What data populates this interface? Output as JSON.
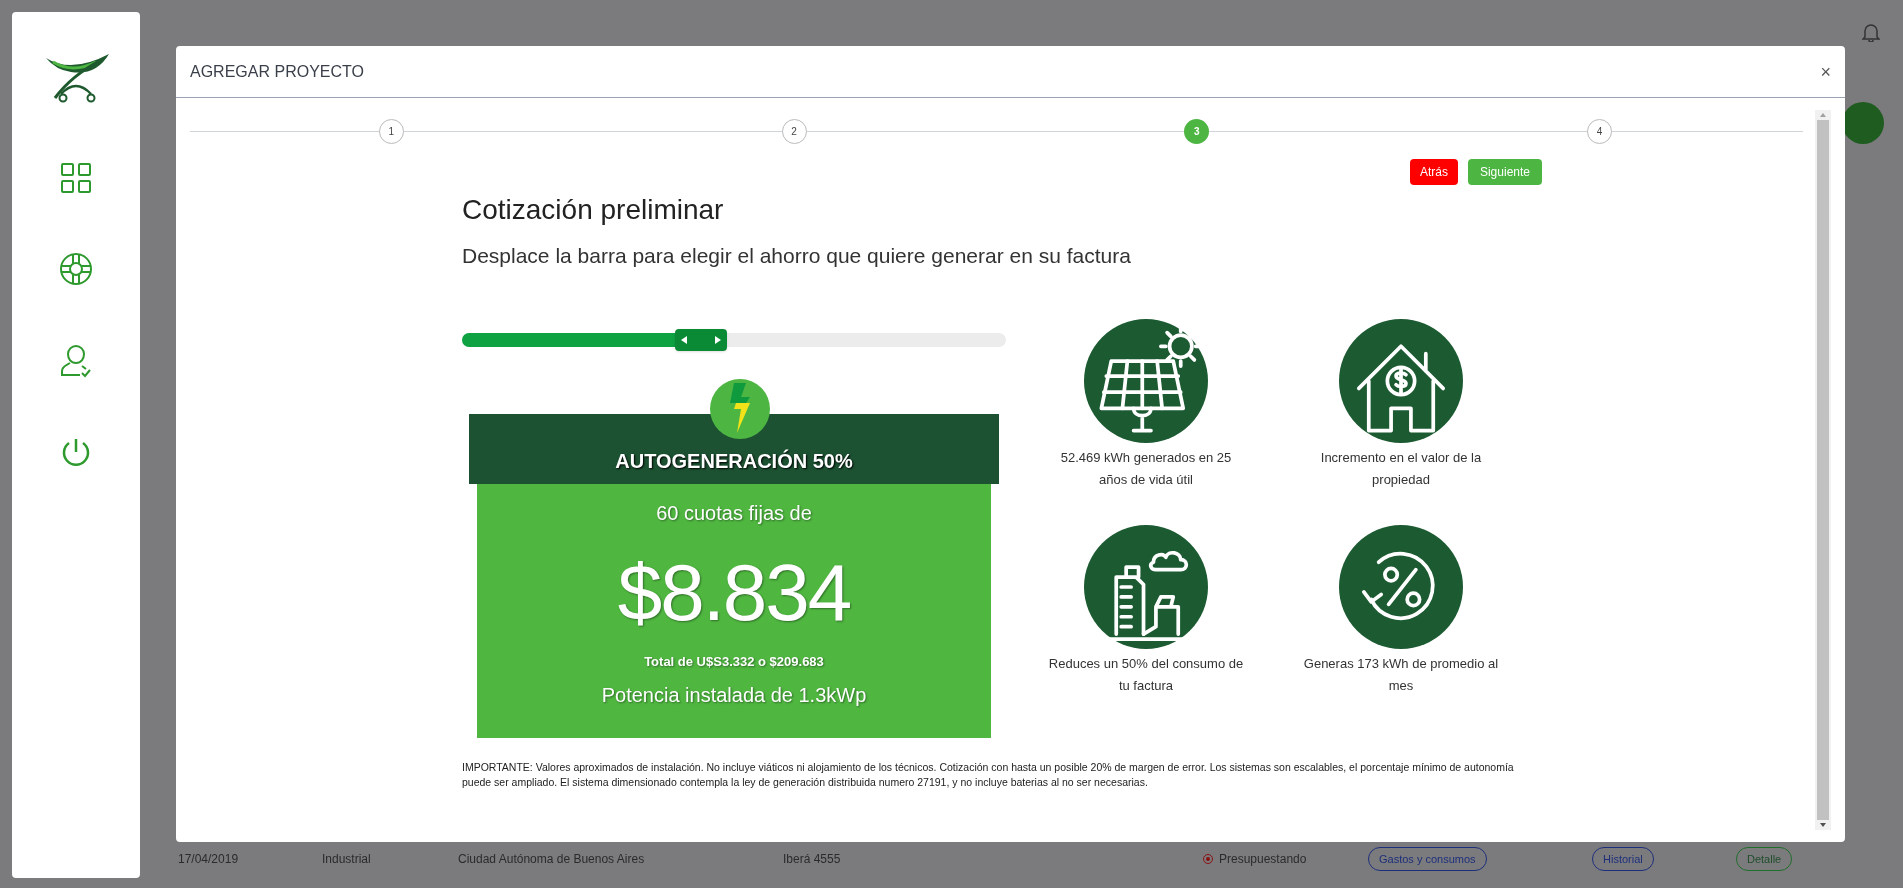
{
  "background_row": {
    "cells": [
      "17/04/2019",
      "Industrial",
      "Ciudad Autónoma de Buenos Aires",
      "Iberá 4555"
    ],
    "status": "Presupuestando",
    "actions": [
      {
        "label": "Gastos y consumos",
        "kind": "blue"
      },
      {
        "label": "Historial",
        "kind": "blue"
      },
      {
        "label": "Detalle",
        "kind": "green"
      }
    ]
  },
  "modal": {
    "title": "AGREGAR PROYECTO",
    "close": "×",
    "steps": [
      {
        "label": "1",
        "selected": false
      },
      {
        "label": "2",
        "selected": false
      },
      {
        "label": "3",
        "selected": true
      },
      {
        "label": "4",
        "selected": false
      }
    ],
    "buttons": [
      {
        "label": "Atrás",
        "kind": "back"
      },
      {
        "label": "Siguiente",
        "kind": "next"
      }
    ],
    "heading": "Cotización preliminar",
    "subheading": "Desplace la barra para elegir el ahorro que quiere generar en su factura",
    "slider": {
      "level": 0.44
    },
    "plan": {
      "title": "AUTOGENERACIÓN 50%",
      "installments": "60 cuotas fijas de",
      "price": "$8.834",
      "total": "Total de U$S3.332 o $209.683",
      "power": "Potencia instalada de 1.3kWp"
    },
    "benefits": [
      {
        "kind": "solar",
        "text": "52.469 kWh generados en 25 años de vida útil"
      },
      {
        "kind": "house",
        "text": "Incremento en el valor de la propiedad"
      },
      {
        "kind": "factory",
        "text": "Reduces un 50% del consumo de tu factura"
      },
      {
        "kind": "percent",
        "text": "Generas 173 kWh de promedio al mes"
      }
    ],
    "disclaimer": "IMPORTANTE: Valores aproximados de instalación. No incluye viáticos ni alojamiento de los técnicos. Cotización con hasta un posible 20% de margen de error. Los sistemas son escalables, el porcentaje mínimo de autonomía puede ser ampliado. El sistema dimensionado contempla la ley de generación distribuida numero 27191, y no incluye baterias al no ser necesarias."
  }
}
